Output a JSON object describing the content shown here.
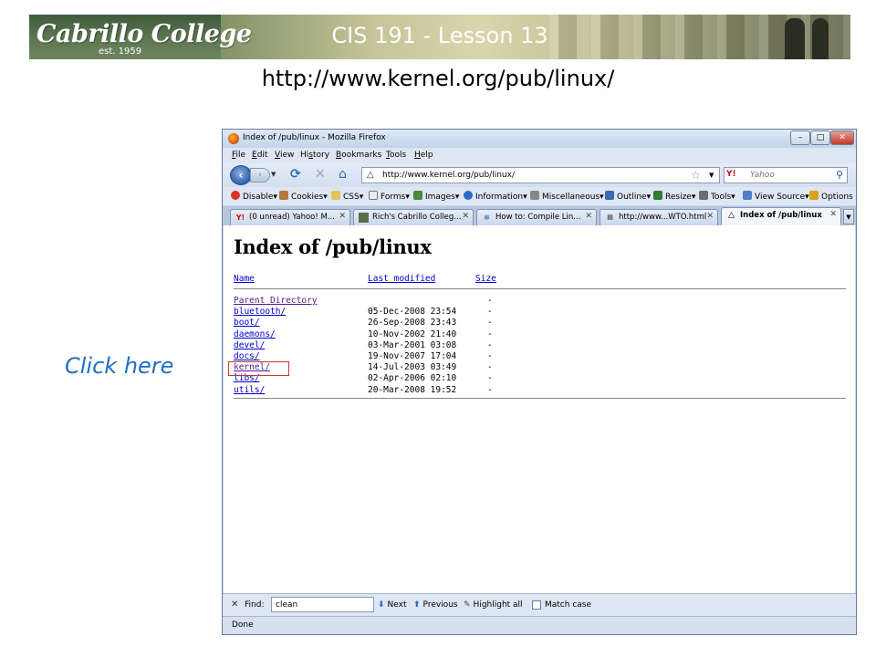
{
  "slide": {
    "logo_text": "Cabrillo College",
    "logo_est": "est. 1959",
    "title": "CIS 191 - Lesson 13",
    "url_caption": "http://www.kernel.org/pub/linux/",
    "callout": "Click here"
  },
  "colors": {
    "callout": "#1f6fc4",
    "link": "#0000cc",
    "visited": "#551a8b",
    "highlight": "#c0392b"
  },
  "window": {
    "title": "Index of /pub/linux - Mozilla Firefox"
  },
  "menu": [
    "File",
    "Edit",
    "View",
    "History",
    "Bookmarks",
    "Tools",
    "Help"
  ],
  "menu_accel": [
    "F",
    "E",
    "V",
    "s",
    "B",
    "T",
    "H"
  ],
  "nav": {
    "url": "http://www.kernel.org/pub/linux/",
    "search_placeholder": "Yahoo",
    "search_engine": "Y!"
  },
  "devbar": [
    "Disable",
    "Cookies",
    "CSS",
    "Forms",
    "Images",
    "Information",
    "Miscellaneous",
    "Outline",
    "Resize",
    "Tools",
    "View Source",
    "Options"
  ],
  "tabs": [
    {
      "label": "(0 unread) Yahoo! M...",
      "icon": "yahoo-icon"
    },
    {
      "label": "Rich's Cabrillo Colleg...",
      "icon": "cabrillo-icon"
    },
    {
      "label": "How to: Compile Lin...",
      "icon": "howto-icon"
    },
    {
      "label": "http://www...WTO.html",
      "icon": "page-icon"
    },
    {
      "label": "Index of /pub/linux",
      "icon": "tux-icon"
    }
  ],
  "page": {
    "heading": "Index of /pub/linux",
    "columns": {
      "name": "Name",
      "modified": "Last modified",
      "size": "Size"
    },
    "rows": [
      {
        "name": "Parent Directory",
        "modified": "",
        "size": "-"
      },
      {
        "name": "bluetooth/",
        "modified": "05-Dec-2008 23:54",
        "size": "-"
      },
      {
        "name": "boot/",
        "modified": "26-Sep-2008 23:43",
        "size": "-"
      },
      {
        "name": "daemons/",
        "modified": "10-Nov-2002 21:40",
        "size": "-"
      },
      {
        "name": "devel/",
        "modified": "03-Mar-2001 03:08",
        "size": "-"
      },
      {
        "name": "docs/",
        "modified": "19-Nov-2007 17:04",
        "size": "-"
      },
      {
        "name": "kernel/",
        "modified": "14-Jul-2003 03:49",
        "size": "-"
      },
      {
        "name": "libs/",
        "modified": "02-Apr-2006 02:10",
        "size": "-"
      },
      {
        "name": "utils/",
        "modified": "20-Mar-2008 19:52",
        "size": "-"
      }
    ]
  },
  "findbar": {
    "label": "Find:",
    "value": "clean",
    "next": "Next",
    "previous": "Previous",
    "highlight": "Highlight all",
    "match_case": "Match case"
  },
  "status": "Done"
}
